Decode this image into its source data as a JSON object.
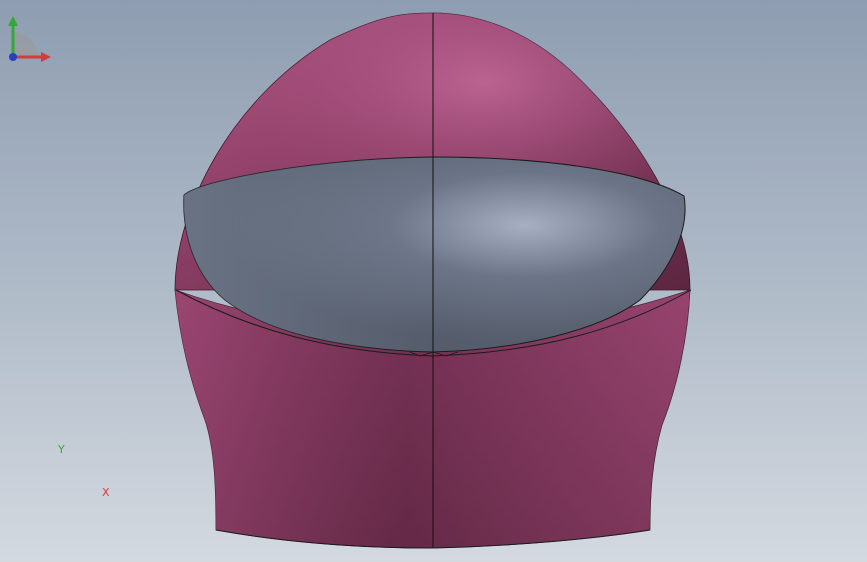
{
  "viewport": {
    "background_top": "#8e9db1",
    "background_bottom": "#d4d9e0"
  },
  "model": {
    "shell_color": "#a24b78",
    "visor_color": "#6e7889",
    "edge_color": "#1b1b1b"
  },
  "triad": {
    "x_label": "X",
    "y_label": "Y",
    "x_color": "#d63a3a",
    "y_color": "#36a83a",
    "z_color": "#2a3fbf"
  }
}
